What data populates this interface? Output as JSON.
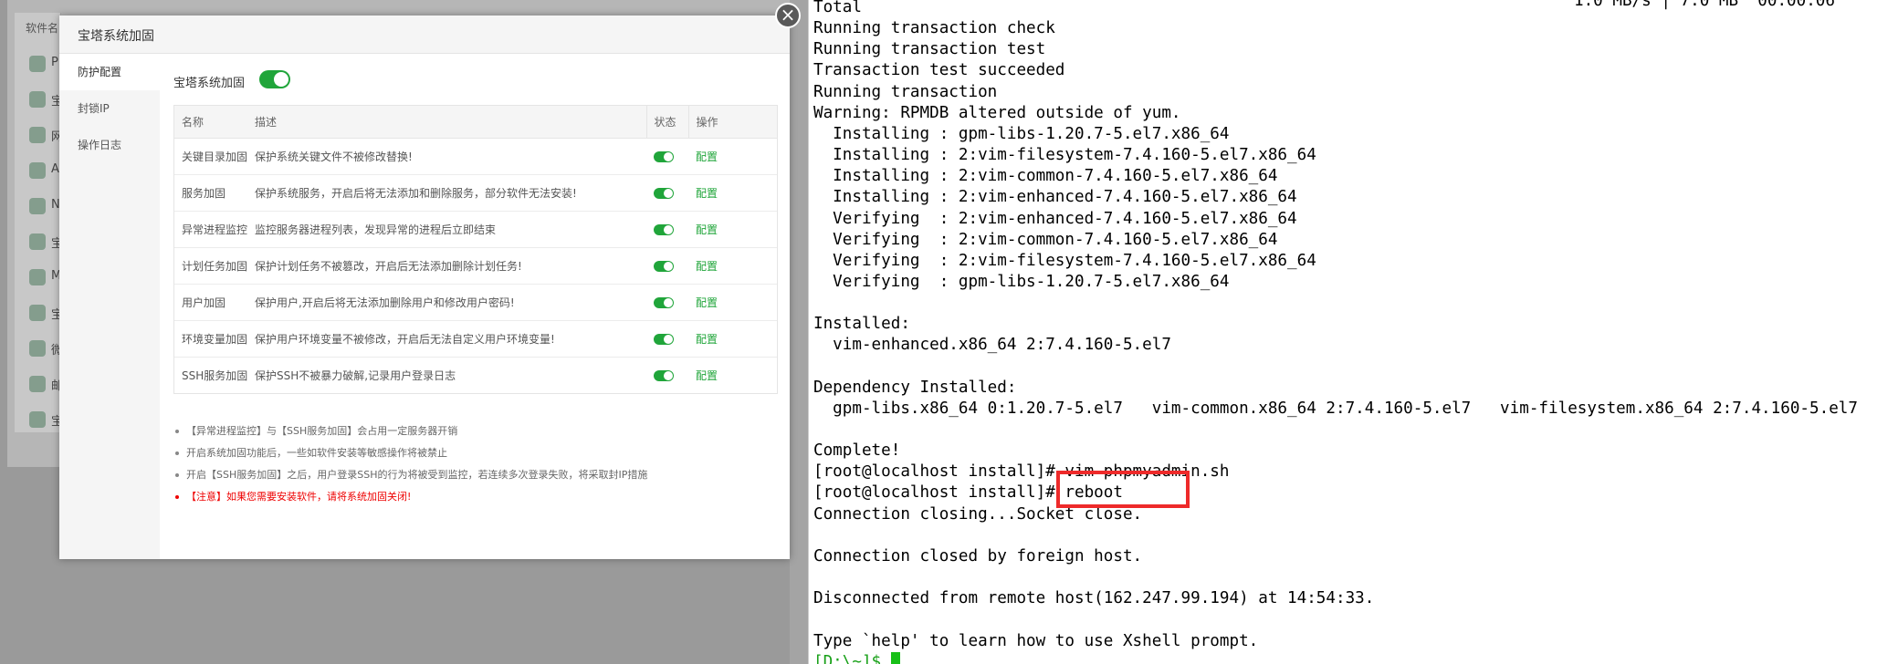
{
  "background_panel": {
    "header": "软件名",
    "items": [
      {
        "icon": "app-icon",
        "label": "P"
      },
      {
        "icon": "shield-icon",
        "label": "宝"
      },
      {
        "icon": "globe-icon",
        "label": "网"
      },
      {
        "icon": "apache-icon",
        "label": "A"
      },
      {
        "icon": "nginx-icon",
        "label": "N"
      },
      {
        "icon": "sitemap-icon",
        "label": "宝"
      },
      {
        "icon": "cloud-upload-icon",
        "label": "M"
      },
      {
        "icon": "monitor-icon",
        "label": "宝"
      },
      {
        "icon": "link-icon",
        "label": "微"
      },
      {
        "icon": "mail-icon",
        "label": "邮"
      },
      {
        "icon": "database-icon",
        "label": "宝"
      }
    ]
  },
  "modal": {
    "title": "宝塔系统加固",
    "close_icon": "×",
    "nav": [
      "防护配置",
      "封锁IP",
      "操作日志"
    ],
    "toggle_label": "宝塔系统加固",
    "toggle_on": true,
    "accent_color": "#20a53a",
    "table": {
      "headers": [
        "名称",
        "描述",
        "状态",
        "操作"
      ],
      "rows": [
        {
          "name": "关键目录加固",
          "desc": "保护系统关键文件不被修改替换!",
          "enabled": true,
          "action": "配置"
        },
        {
          "name": "服务加固",
          "desc": "保护系统服务，开启后将无法添加和删除服务，部分软件无法安装!",
          "enabled": true,
          "action": "配置"
        },
        {
          "name": "异常进程监控",
          "desc": "监控服务器进程列表，发现异常的进程后立即结束",
          "enabled": true,
          "action": "配置"
        },
        {
          "name": "计划任务加固",
          "desc": "保护计划任务不被篡改，开启后无法添加删除计划任务!",
          "enabled": true,
          "action": "配置"
        },
        {
          "name": "用户加固",
          "desc": "保护用户,开启后将无法添加删除用户和修改用户密码!",
          "enabled": true,
          "action": "配置"
        },
        {
          "name": "环境变量加固",
          "desc": "保护用户环境变量不被修改，开启后无法自定义用户环境变量!",
          "enabled": true,
          "action": "配置"
        },
        {
          "name": "SSH服务加固",
          "desc": "保护SSH不被暴力破解,记录用户登录日志",
          "enabled": true,
          "action": "配置"
        }
      ]
    },
    "notes": [
      "【异常进程监控】与【SSH服务加固】会占用一定服务器开销",
      "开启系统加固功能后，一些如软件安装等敏感操作将被禁止",
      "开启【SSH服务加固】之后，用户登录SSH的行为将被受到监控，若连续多次登录失败，将采取封IP措施"
    ],
    "warning_note": "【注意】如果您需要安装软件，请将系统加固关闭!",
    "warning_color": "#ee0000"
  },
  "terminal": {
    "top_right": "1.0 MB/s | 7.0 MB  00:00:06",
    "lines": [
      "Total",
      "Running transaction check",
      "Running transaction test",
      "Transaction test succeeded",
      "Running transaction",
      "Warning: RPMDB altered outside of yum.",
      "  Installing : gpm-libs-1.20.7-5.el7.x86_64",
      "  Installing : 2:vim-filesystem-7.4.160-5.el7.x86_64",
      "  Installing : 2:vim-common-7.4.160-5.el7.x86_64",
      "  Installing : 2:vim-enhanced-7.4.160-5.el7.x86_64",
      "  Verifying  : 2:vim-enhanced-7.4.160-5.el7.x86_64",
      "  Verifying  : 2:vim-common-7.4.160-5.el7.x86_64",
      "  Verifying  : 2:vim-filesystem-7.4.160-5.el7.x86_64",
      "  Verifying  : gpm-libs-1.20.7-5.el7.x86_64",
      "",
      "Installed:",
      "  vim-enhanced.x86_64 2:7.4.160-5.el7",
      "",
      "Dependency Installed:",
      "  gpm-libs.x86_64 0:1.20.7-5.el7   vim-common.x86_64 2:7.4.160-5.el7   vim-filesystem.x86_64 2:7.4.160-5.el7",
      "",
      "Complete!",
      "[root@localhost install]# vim phpmyadmin.sh",
      "[root@localhost install]# reboot",
      "Connection closing...Socket close.",
      "",
      "Connection closed by foreign host.",
      "",
      "Disconnected from remote host(162.247.99.194) at 14:54:33.",
      "",
      "Type `help' to learn how to use Xshell prompt."
    ],
    "prompt": "[D:\\~]$ ",
    "prompt_color": "#18a018",
    "highlight_color": "#ee2a2a"
  }
}
